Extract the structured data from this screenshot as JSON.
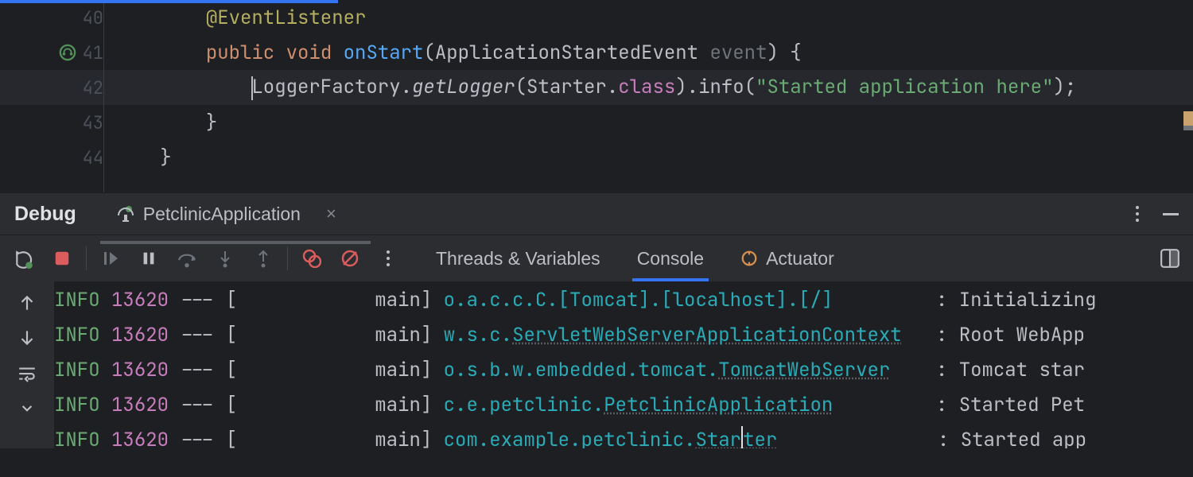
{
  "code": {
    "lines": [
      {
        "num": "40"
      },
      {
        "num": "41"
      },
      {
        "num": "42"
      },
      {
        "num": "43"
      },
      {
        "num": "44"
      }
    ],
    "tokens": {
      "annotation": "@EventListener",
      "kw_public": "public",
      "kw_void": "void",
      "method": "onStart",
      "param_type": "ApplicationStartedEvent",
      "param_name": "event",
      "open_paren": "(",
      "close_paren": ")",
      "open_brace": " {",
      "logger_factory": "LoggerFactory",
      "dot1": ".",
      "get_logger": "getLogger",
      "starter": "Starter",
      "class_kw": "class",
      "info": "info",
      "string": "\"Started application here\"",
      "semi": ";",
      "close_brace": "}"
    }
  },
  "debug": {
    "title": "Debug",
    "tab": "PetclinicApplication"
  },
  "toolbar_tabs": {
    "threads": "Threads & Variables",
    "console": "Console",
    "actuator": "Actuator"
  },
  "console": {
    "rows": [
      {
        "level": "INFO",
        "pid": "13620",
        "dash": "---",
        "th_open": "[",
        "thread": "main",
        "th_close": "]",
        "logger": "o.a.c.c.C.[Tomcat].[localhost].[/]",
        "logger_u": "",
        "colon": ":",
        "msg": "Initializing"
      },
      {
        "level": "INFO",
        "pid": "13620",
        "dash": "---",
        "th_open": "[",
        "thread": "main",
        "th_close": "]",
        "logger": "w.s.c.",
        "logger_u": "ServletWebServerApplicationContext",
        "colon": ":",
        "msg": "Root WebApp"
      },
      {
        "level": "INFO",
        "pid": "13620",
        "dash": "---",
        "th_open": "[",
        "thread": "main",
        "th_close": "]",
        "logger": "o.s.b.w.embedded.tomcat.",
        "logger_u": "TomcatWebServer",
        "colon": ":",
        "msg": "Tomcat star"
      },
      {
        "level": "INFO",
        "pid": "13620",
        "dash": "---",
        "th_open": "[",
        "thread": "main",
        "th_close": "]",
        "logger": "c.e.petclinic.",
        "logger_u": "PetclinicApplication",
        "colon": ":",
        "msg": "Started Pet"
      },
      {
        "level": "INFO",
        "pid": "13620",
        "dash": "---",
        "th_open": "[",
        "thread": "main",
        "th_close": "]",
        "logger": "com.example.petclinic.",
        "logger_u": "Starter",
        "colon": ":",
        "msg": "Started app"
      }
    ]
  }
}
